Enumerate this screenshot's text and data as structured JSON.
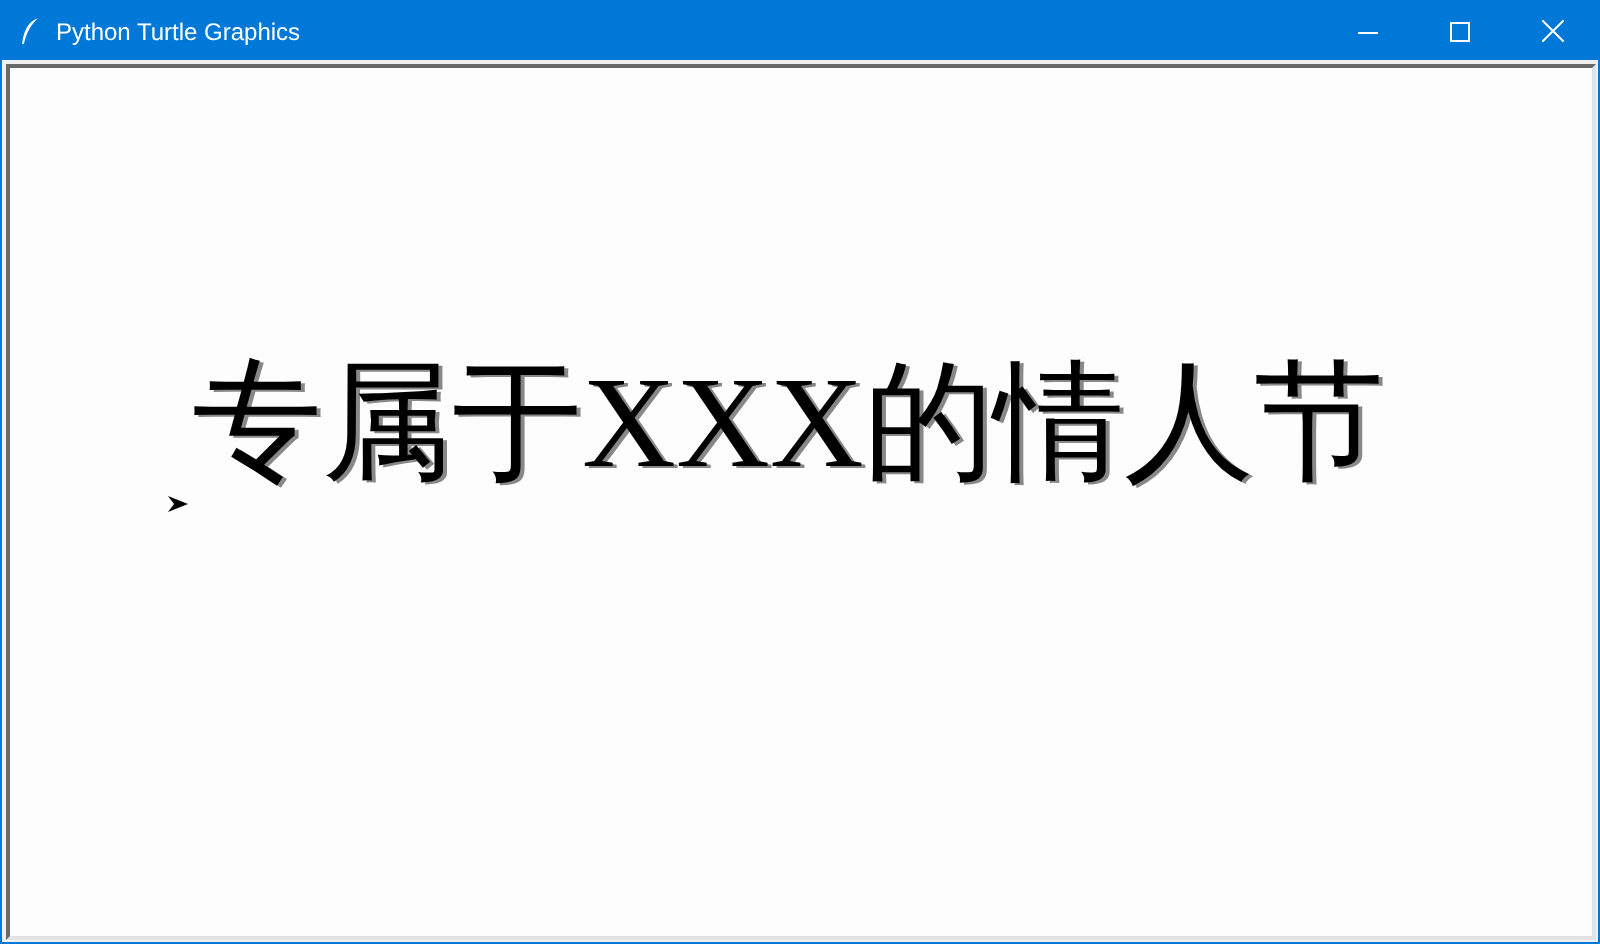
{
  "window": {
    "title": "Python Turtle Graphics"
  },
  "canvas": {
    "text": "专属于XXX的情人节"
  }
}
